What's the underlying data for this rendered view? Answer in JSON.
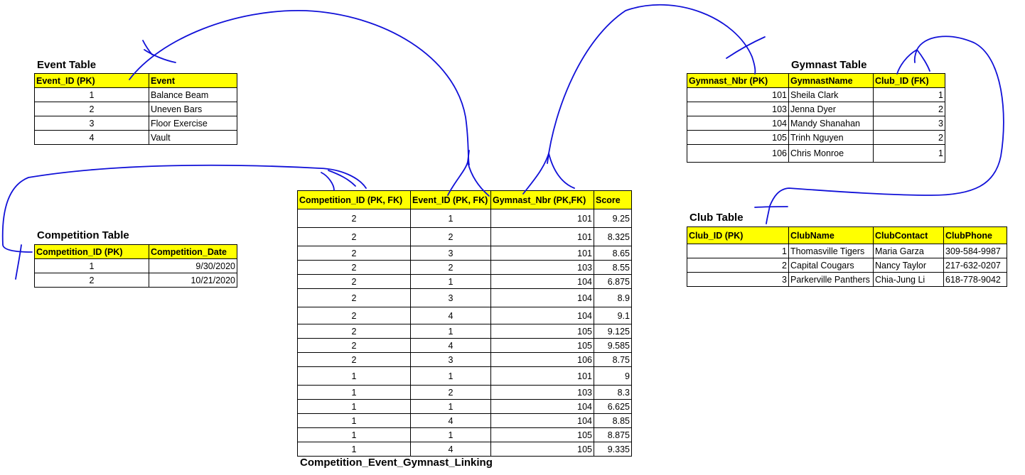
{
  "event_table": {
    "title": "Event Table",
    "headers": [
      "Event_ID (PK)",
      "Event"
    ],
    "rows": [
      [
        "1",
        "Balance Beam"
      ],
      [
        "2",
        "Uneven Bars"
      ],
      [
        "3",
        "Floor Exercise"
      ],
      [
        "4",
        "Vault"
      ]
    ]
  },
  "competition_table": {
    "title": "Competition Table",
    "headers": [
      "Competition_ID (PK)",
      "Competition_Date"
    ],
    "rows": [
      [
        "1",
        "9/30/2020"
      ],
      [
        "2",
        "10/21/2020"
      ]
    ]
  },
  "gymnast_table": {
    "title": "Gymnast Table",
    "headers": [
      "Gymnast_Nbr (PK)",
      "GymnastName",
      "Club_ID (FK)"
    ],
    "rows": [
      [
        "101",
        "Sheila Clark",
        "1"
      ],
      [
        "103",
        "Jenna Dyer",
        "2"
      ],
      [
        "104",
        "Mandy Shanahan",
        "3"
      ],
      [
        "105",
        "Trinh Nguyen",
        "2"
      ],
      [
        "106",
        "Chris Monroe",
        "1"
      ]
    ]
  },
  "club_table": {
    "title": "Club Table",
    "headers": [
      "Club_ID (PK)",
      "ClubName",
      "ClubContact",
      "ClubPhone"
    ],
    "rows": [
      [
        "1",
        "Thomasville Tigers",
        "Maria Garza",
        "309-584-9987"
      ],
      [
        "2",
        "Capital Cougars",
        "Nancy Taylor",
        "217-632-0207"
      ],
      [
        "3",
        "Parkerville Panthers",
        "Chia-Jung Li",
        "618-778-9042"
      ]
    ]
  },
  "linking_table": {
    "title": "Competition_Event_Gymnast_Linking",
    "headers": [
      "Competition_ID (PK, FK)",
      "Event_ID (PK, FK)",
      "Gymnast_Nbr (PK,FK)",
      "Score"
    ],
    "rows": [
      [
        "2",
        "1",
        "101",
        "9.25"
      ],
      [
        "2",
        "2",
        "101",
        "8.325"
      ],
      [
        "2",
        "3",
        "101",
        "8.65"
      ],
      [
        "2",
        "2",
        "103",
        "8.55"
      ],
      [
        "2",
        "1",
        "104",
        "6.875"
      ],
      [
        "2",
        "3",
        "104",
        "8.9"
      ],
      [
        "2",
        "4",
        "104",
        "9.1"
      ],
      [
        "2",
        "1",
        "105",
        "9.125"
      ],
      [
        "2",
        "4",
        "105",
        "9.585"
      ],
      [
        "2",
        "3",
        "106",
        "8.75"
      ],
      [
        "1",
        "1",
        "101",
        "9"
      ],
      [
        "1",
        "2",
        "103",
        "8.3"
      ],
      [
        "1",
        "1",
        "104",
        "6.625"
      ],
      [
        "1",
        "4",
        "104",
        "8.85"
      ],
      [
        "1",
        "1",
        "105",
        "8.875"
      ],
      [
        "1",
        "4",
        "105",
        "9.335"
      ]
    ]
  },
  "annotation_color": "#1010d8",
  "header_color": "#ffff00"
}
